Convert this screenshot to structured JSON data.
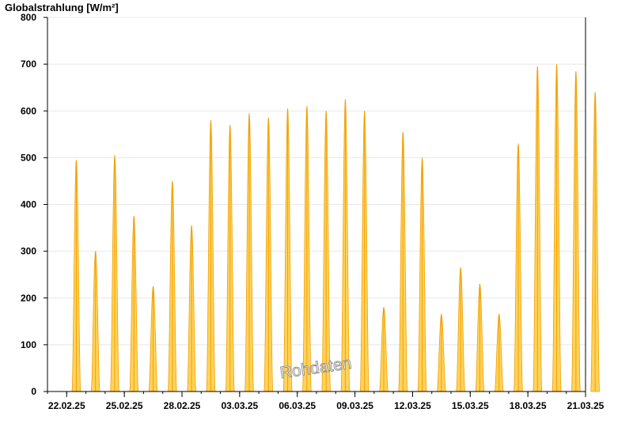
{
  "chart_data": {
    "type": "area",
    "title": "Globalstrahlung [W/m²]",
    "xlabel": "",
    "ylabel": "",
    "ylim": [
      0,
      800
    ],
    "yticks": [
      0,
      100,
      200,
      300,
      400,
      500,
      600,
      700,
      800
    ],
    "xlim": [
      "2025-02-21",
      "2025-03-21"
    ],
    "xtick_labels": [
      "22.02.25",
      "25.02.25",
      "28.02.25",
      "03.03.25",
      "06.03.25",
      "09.03.25",
      "12.03.25",
      "15.03.25",
      "18.03.25",
      "21.03.25"
    ],
    "grid": "horizontal",
    "watermark": "Rohdaten",
    "colors": {
      "fill": "#ffd35c",
      "stroke": "#f0a000",
      "axis": "#000000",
      "grid": "#e8e8e8"
    },
    "series": [
      {
        "daily_max": [
          {
            "date": "2025-02-22",
            "value": 495
          },
          {
            "date": "2025-02-23",
            "value": 300
          },
          {
            "date": "2025-02-24",
            "value": 505
          },
          {
            "date": "2025-02-25",
            "value": 375
          },
          {
            "date": "2025-02-26",
            "value": 225
          },
          {
            "date": "2025-02-27",
            "value": 450
          },
          {
            "date": "2025-02-28",
            "value": 355
          },
          {
            "date": "2025-03-01",
            "value": 580
          },
          {
            "date": "2025-03-02",
            "value": 570
          },
          {
            "date": "2025-03-03",
            "value": 595
          },
          {
            "date": "2025-03-04",
            "value": 585
          },
          {
            "date": "2025-03-05",
            "value": 605
          },
          {
            "date": "2025-03-06",
            "value": 610
          },
          {
            "date": "2025-03-07",
            "value": 600
          },
          {
            "date": "2025-03-08",
            "value": 625
          },
          {
            "date": "2025-03-09",
            "value": 600
          },
          {
            "date": "2025-03-10",
            "value": 180
          },
          {
            "date": "2025-03-11",
            "value": 555
          },
          {
            "date": "2025-03-12",
            "value": 500
          },
          {
            "date": "2025-03-13",
            "value": 165
          },
          {
            "date": "2025-03-14",
            "value": 265
          },
          {
            "date": "2025-03-15",
            "value": 230
          },
          {
            "date": "2025-03-16",
            "value": 165
          },
          {
            "date": "2025-03-17",
            "value": 530
          },
          {
            "date": "2025-03-18",
            "value": 695
          },
          {
            "date": "2025-03-19",
            "value": 700
          },
          {
            "date": "2025-03-20",
            "value": 685
          },
          {
            "date": "2025-03-21",
            "value": 640
          }
        ]
      }
    ]
  }
}
